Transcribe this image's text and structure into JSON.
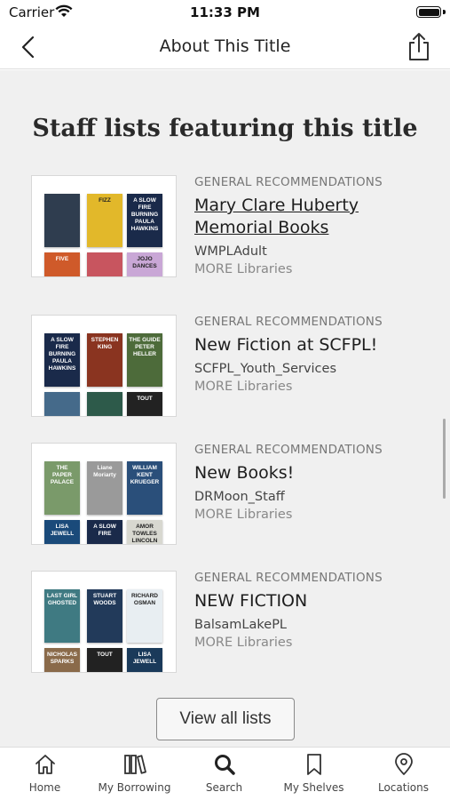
{
  "status_bar": {
    "carrier": "Carrier",
    "time": "11:33 PM"
  },
  "nav": {
    "title": "About This Title",
    "back_icon": "chevron-left-icon",
    "share_icon": "share-icon"
  },
  "section": {
    "title": "Staff lists featuring this title"
  },
  "lists": [
    {
      "category": "GENERAL RECOMMENDATIONS",
      "title": "Mary Clare Huberty Memorial Books",
      "owner": "WMPLAdult",
      "more": "MORE Libraries",
      "covers": [
        {
          "text": "",
          "color": "#2f3d4f"
        },
        {
          "text": "FIZZ",
          "color": "#e2b82a"
        },
        {
          "text": "A SLOW FIRE BURNING PAULA HAWKINS",
          "color": "#1a2a4a"
        },
        {
          "text": "FIVE",
          "color": "#cf5a2a"
        },
        {
          "text": "",
          "color": "#c8555f"
        },
        {
          "text": "JOJO DANCES",
          "color": "#c9a7d6"
        }
      ]
    },
    {
      "category": "GENERAL RECOMMENDATIONS",
      "title": "New Fiction at SCFPL!",
      "owner": "SCFPL_Youth_Services",
      "more": "MORE Libraries",
      "covers": [
        {
          "text": "A SLOW FIRE BURNING PAULA HAWKINS",
          "color": "#1a2a4a"
        },
        {
          "text": "STEPHEN KING",
          "color": "#8a3420"
        },
        {
          "text": "THE GUIDE PETER HELLER",
          "color": "#4d6b3a"
        },
        {
          "text": "",
          "color": "#456a8a"
        },
        {
          "text": "",
          "color": "#2d5a4a"
        },
        {
          "text": "TOUT",
          "color": "#222222"
        }
      ]
    },
    {
      "category": "GENERAL RECOMMENDATIONS",
      "title": "New Books!",
      "owner": "DRMoon_Staff",
      "more": "MORE Libraries",
      "covers": [
        {
          "text": "THE PAPER PALACE",
          "color": "#7a9a6a"
        },
        {
          "text": "Liane Moriarty",
          "color": "#9a9a9a"
        },
        {
          "text": "WILLIAM KENT KRUEGER",
          "color": "#2a4f7a"
        },
        {
          "text": "LISA JEWELL",
          "color": "#1a4a7a"
        },
        {
          "text": "A SLOW FIRE",
          "color": "#1a2a4a"
        },
        {
          "text": "AMOR TOWLES LINCOLN",
          "color": "#d8d8d0"
        }
      ]
    },
    {
      "category": "GENERAL RECOMMENDATIONS",
      "title": "NEW FICTION",
      "owner": "BalsamLakePL",
      "more": "MORE Libraries",
      "covers": [
        {
          "text": "LAST GIRL GHOSTED",
          "color": "#3f7a82"
        },
        {
          "text": "STUART WOODS",
          "color": "#223a5a"
        },
        {
          "text": "RICHARD OSMAN",
          "color": "#e8eef2"
        },
        {
          "text": "NICHOLAS SPARKS",
          "color": "#8a6a4a"
        },
        {
          "text": "TOUT",
          "color": "#222222"
        },
        {
          "text": "LISA JEWELL",
          "color": "#1a3a5a"
        }
      ]
    }
  ],
  "view_all_label": "View all lists",
  "tabs": [
    {
      "label": "Home",
      "icon": "home-icon"
    },
    {
      "label": "My Borrowing",
      "icon": "books-icon"
    },
    {
      "label": "Search",
      "icon": "search-icon"
    },
    {
      "label": "My Shelves",
      "icon": "bookmark-icon"
    },
    {
      "label": "Locations",
      "icon": "location-pin-icon"
    }
  ]
}
